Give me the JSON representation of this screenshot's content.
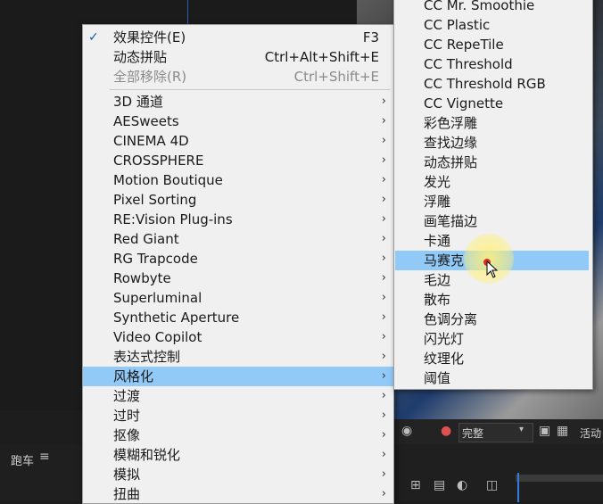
{
  "left_menu": {
    "items": [
      {
        "label": "效果控件(E)",
        "shortcut": "F3",
        "checked": true
      },
      {
        "label": "动态拼贴",
        "shortcut": "Ctrl+Alt+Shift+E"
      },
      {
        "label": "全部移除(R)",
        "shortcut": "Ctrl+Shift+E",
        "disabled": true
      },
      {
        "label": "3D 通道",
        "submenu": true
      },
      {
        "label": "AESweets",
        "submenu": true
      },
      {
        "label": "CINEMA 4D",
        "submenu": true
      },
      {
        "label": "CROSSPHERE",
        "submenu": true
      },
      {
        "label": "Motion Boutique",
        "submenu": true
      },
      {
        "label": "Pixel Sorting",
        "submenu": true
      },
      {
        "label": "RE:Vision Plug-ins",
        "submenu": true
      },
      {
        "label": "Red Giant",
        "submenu": true
      },
      {
        "label": "RG Trapcode",
        "submenu": true
      },
      {
        "label": "Rowbyte",
        "submenu": true
      },
      {
        "label": "Superluminal",
        "submenu": true
      },
      {
        "label": "Synthetic Aperture",
        "submenu": true
      },
      {
        "label": "Video Copilot",
        "submenu": true
      },
      {
        "label": "表达式控制",
        "submenu": true
      },
      {
        "label": "风格化",
        "submenu": true,
        "highlighted": true
      },
      {
        "label": "过渡",
        "submenu": true
      },
      {
        "label": "过时",
        "submenu": true
      },
      {
        "label": "抠像",
        "submenu": true
      },
      {
        "label": "模糊和锐化",
        "submenu": true
      },
      {
        "label": "模拟",
        "submenu": true
      },
      {
        "label": "扭曲",
        "submenu": true
      }
    ],
    "check_glyph": "✓",
    "arrow_glyph": "›"
  },
  "sub_menu": {
    "items": [
      {
        "label": "CC Mr. Smoothie"
      },
      {
        "label": "CC Plastic"
      },
      {
        "label": "CC RepeTile"
      },
      {
        "label": "CC Threshold"
      },
      {
        "label": "CC Threshold RGB"
      },
      {
        "label": "CC Vignette"
      },
      {
        "label": "彩色浮雕"
      },
      {
        "label": "查找边缘"
      },
      {
        "label": "动态拼贴"
      },
      {
        "label": "发光"
      },
      {
        "label": "浮雕"
      },
      {
        "label": "画笔描边"
      },
      {
        "label": "卡通"
      },
      {
        "label": "马赛克",
        "highlighted": true
      },
      {
        "label": "毛边"
      },
      {
        "label": "散布"
      },
      {
        "label": "色调分离"
      },
      {
        "label": "闪光灯"
      },
      {
        "label": "纹理化"
      },
      {
        "label": "阈值"
      }
    ]
  },
  "bottom_bar": {
    "panel_tab": "跑车",
    "quality_select": "完整",
    "active_label": "活动"
  },
  "colors": {
    "menu_bg": "#f0f0f0",
    "highlight": "#91c9f7",
    "app_bg": "#1d1d1d"
  }
}
